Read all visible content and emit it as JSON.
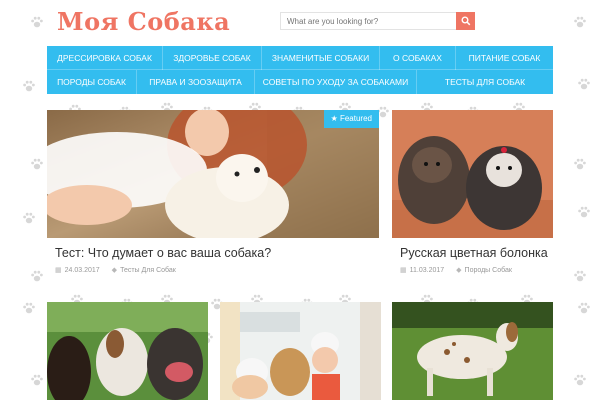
{
  "site": {
    "logo": "Моя Собака"
  },
  "search": {
    "placeholder": "What are you looking for?"
  },
  "menu": {
    "row1": [
      "ДРЕССИРОВКА СОБАК",
      "ЗДОРОВЬЕ СОБАК",
      "ЗНАМЕНИТЫЕ СОБАКИ",
      "О СОБАКАХ",
      "ПИТАНИЕ СОБАК"
    ],
    "row2": [
      "ПОРОДЫ СОБАК",
      "ПРАВА И ЗООЗАЩИТА",
      "СОВЕТЫ ПО УХОДУ ЗА СОБАКАМИ",
      "ТЕСТЫ ДЛЯ СОБАК"
    ]
  },
  "posts": [
    {
      "badge": "Featured",
      "title": "Тест: Что думает о вас ваша собака?",
      "date": "24.03.2017",
      "category": "Тесты Для Собак"
    },
    {
      "title": "Русская цветная болонка",
      "date": "11.03.2017",
      "category": "Породы Собак"
    }
  ],
  "colors": {
    "accent": "#33bdef",
    "brand": "#ef7563"
  }
}
